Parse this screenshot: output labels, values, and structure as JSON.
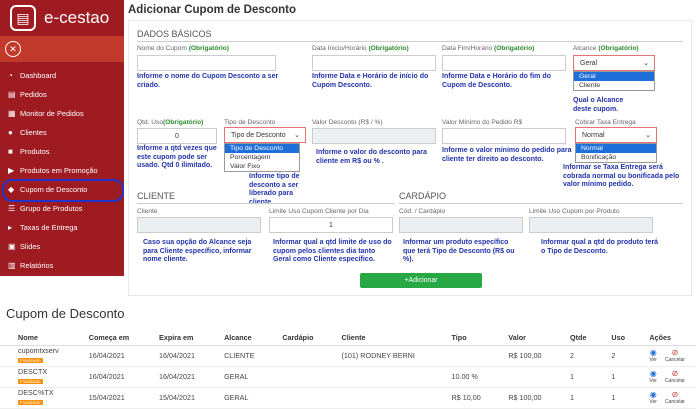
{
  "brand": {
    "name": "e-cestao"
  },
  "sidebar": {
    "items": [
      {
        "label": "Dashboard"
      },
      {
        "label": "Pedidos"
      },
      {
        "label": "Monitor de Pedidos"
      },
      {
        "label": "Clientes"
      },
      {
        "label": "Produtos"
      },
      {
        "label": "Produtos em Promoção"
      },
      {
        "label": "Cupom de Desconto"
      },
      {
        "label": "Grupo de Produtos"
      },
      {
        "label": "Taxas de Entrega"
      },
      {
        "label": "Slides"
      },
      {
        "label": "Relatórios"
      }
    ]
  },
  "form": {
    "title": "Adicionar Cupom de Desconto",
    "sec_basic": "DADOS BÁSICOS",
    "sec_client": "CLIENTE",
    "sec_cardapio": "CARDÁPIO",
    "required": "(Obrigatório)",
    "nome_label": "Nome do Cupom",
    "dtini_label": "Data Inicio/Horário",
    "dtfim_label": "Data Fim/Horário",
    "alcance_label": "Alcance",
    "alcance_value": "Geral",
    "alcance_options": [
      "Geral",
      "Cliente"
    ],
    "qtd_label": "Qtd. Uso",
    "qtd_value": "0",
    "tipo_label": "Tipo de Desconto",
    "tipo_value": "Tipo de Desconto",
    "tipo_options": [
      "Tipo de Desconto",
      "Porcentagem",
      "Valor Fixo"
    ],
    "valor_label": "Valor Desconto (R$ / %)",
    "minimo_label": "Valor Mínimo do Pedido R$",
    "taxa_label": "Cobrar Taxa Entrega",
    "taxa_value": "Normal",
    "taxa_options": [
      "Normal",
      "Bonificação"
    ],
    "cliente_label": "Cliente",
    "limite_cli_label": "Limite Uso Cupom Cliente por Dia",
    "limite_cli_value": "1",
    "cod_cardapio_label": "Cód. / Cardápio",
    "limite_prod_label": "Limite Uso Cupom por Produto",
    "add_button": "+Adicionar",
    "notes": {
      "nome": "Informe o nome do Cupom Desconto a ser criado.",
      "datas_ini": "Informe Data e Horário de início do Cupom Desconto.",
      "datas_fim": "Informe Data e Horário do fim do Cupom de Desconto.",
      "alcance": "Qual o Alcance deste cupom.",
      "qtd": "Informe a qtd vezes que este cupom pode ser usado. Qtd 0 ilimitado.",
      "tipo": "Informe tipo de desconto a ser liberado para cliente.",
      "valor": "Informe o valor do desconto para cliente em R$ ou % .",
      "minimo": "Informe o valor mínimo do pedido para cliente ter direito ao desconto.",
      "taxa": "Informar se Taxa Entrega será cobrada normal ou bonificada pelo valor mínimo pedido.",
      "cliente": "Caso sua opção do Alcance seja para Cliente específico, informar nome cliente.",
      "limite_cli": "Informar qual a qtd limite de uso do cupom pelos clientes dia tanto Geral como Cliente específico.",
      "cardapio": "Informar um produto específico que terá Tipo de Desconto (R$ ou %).",
      "limite_prod": "Informar qual a qtd do produto terá o Tipo de Desconto."
    }
  },
  "list": {
    "title": "Cupom de Desconto",
    "headers": [
      "Nome",
      "Começa em",
      "Expira em",
      "Alcance",
      "Cardápio",
      "Cliente",
      "Tipo",
      "Valor",
      "Qtde",
      "Uso",
      "Ações"
    ],
    "badge": "Finalizado",
    "ver": "Ver",
    "cancelar": "Cancelar",
    "rows": [
      {
        "nome": "cupomtxserv",
        "inicio": "16/04/2021",
        "fim": "16/04/2021",
        "alcance": "CLIENTE",
        "cardapio": "",
        "cliente": "(101) RODNEY BERNI",
        "tipo": "",
        "valor": "R$ 100,00",
        "qtde": "2",
        "uso": "2"
      },
      {
        "nome": "DESCTX",
        "inicio": "16/04/2021",
        "fim": "16/04/2021",
        "alcance": "GERAL",
        "cardapio": "",
        "cliente": "",
        "tipo": "10.00 %",
        "valor": "",
        "qtde": "1",
        "uso": "1"
      },
      {
        "nome": "DESC%TX",
        "inicio": "15/04/2021",
        "fim": "15/04/2021",
        "alcance": "GERAL",
        "cardapio": "",
        "cliente": "",
        "tipo": "R$ 10,00",
        "valor": "R$ 100,00",
        "qtde": "1",
        "uso": "1"
      }
    ]
  },
  "colors": {
    "sidebar": "#9e1b22",
    "accent": "#28a745",
    "note": "#2233aa",
    "highlight": "#2233cc"
  }
}
